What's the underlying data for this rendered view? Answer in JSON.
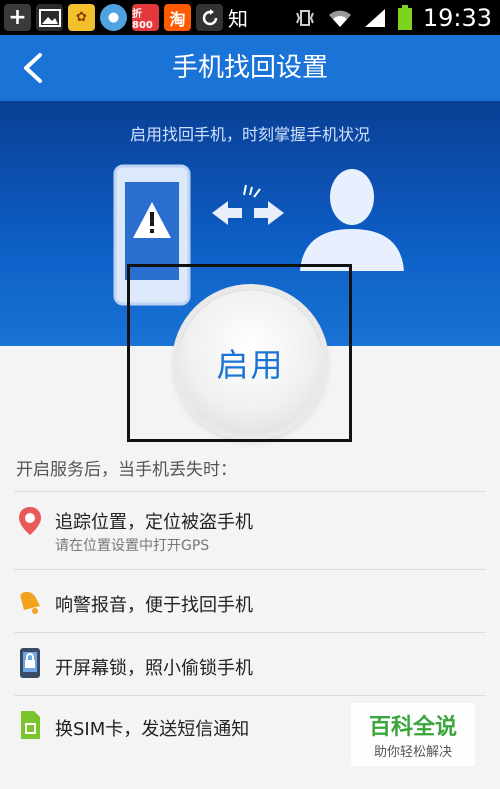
{
  "status_bar": {
    "time": "19:33",
    "app_text": "知",
    "notification_icons": [
      "add-icon",
      "gallery-icon",
      "butterfly-app-icon",
      "chat-bubble-icon",
      "deal-app-icon",
      "taobao-icon",
      "sync-icon"
    ],
    "deal_app_label": "折800",
    "taobao_label": "淘",
    "signal_icons": [
      "vibrate-icon",
      "wifi-icon",
      "cellular-signal-icon",
      "battery-icon"
    ]
  },
  "header": {
    "title": "手机找回设置"
  },
  "banner": {
    "tagline": "启用找回手机，时刻掌握手机状况"
  },
  "enable_button": {
    "label": "启用"
  },
  "intro": "开启服务后，当手机丢失时：",
  "features": [
    {
      "title": "追踪位置，定位被盗手机",
      "subtitle": "请在位置设置中打开GPS",
      "icon": "location-pin-icon"
    },
    {
      "title": "响警报音，便于找回手机",
      "subtitle": "",
      "icon": "alarm-bell-icon"
    },
    {
      "title": "开屏幕锁，照小偷锁手机",
      "subtitle": "",
      "icon": "screen-lock-icon"
    },
    {
      "title": "换SIM卡，发送短信通知",
      "subtitle": "",
      "icon": "sim-card-icon"
    }
  ],
  "watermark": {
    "main": "百科全说",
    "sub": "助你轻松解决"
  },
  "colors": {
    "title_bar": "#1a73d6",
    "accent": "#1a73d6",
    "pin": "#e85a5a",
    "bell": "#f2a21b",
    "sim": "#7cc42b",
    "lock": "#3a4b66"
  }
}
